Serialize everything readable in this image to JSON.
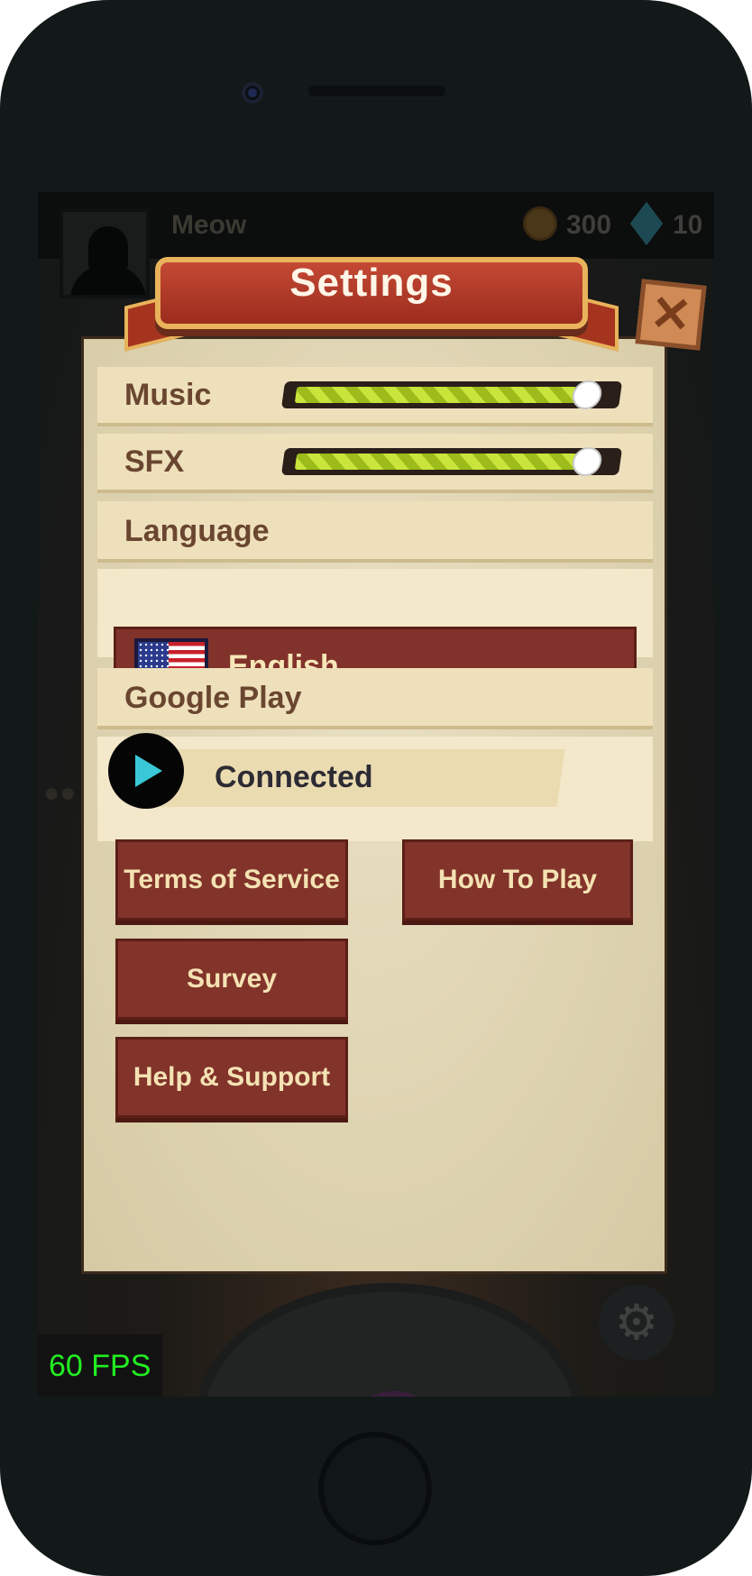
{
  "header": {
    "username": "Meow",
    "coins": "300",
    "gems": "10"
  },
  "settings": {
    "title": "Settings",
    "close_icon": "close-icon",
    "music_label": "Music",
    "music_level": 0.95,
    "sfx_label": "SFX",
    "sfx_level": 0.95,
    "language_label": "Language",
    "language_value": "English",
    "google_play_label": "Google Play",
    "google_play_status": "Connected",
    "buttons": {
      "terms": "Terms of Service",
      "how_to_play": "How To Play",
      "survey": "Survey",
      "help": "Help & Support"
    }
  },
  "fps": "60 FPS",
  "colors": {
    "panel": "#ddd2b0",
    "button": "#82332a",
    "button_text": "#f4e2b3",
    "slider_fill": "#b9d626",
    "fps_text": "#22ee22"
  }
}
